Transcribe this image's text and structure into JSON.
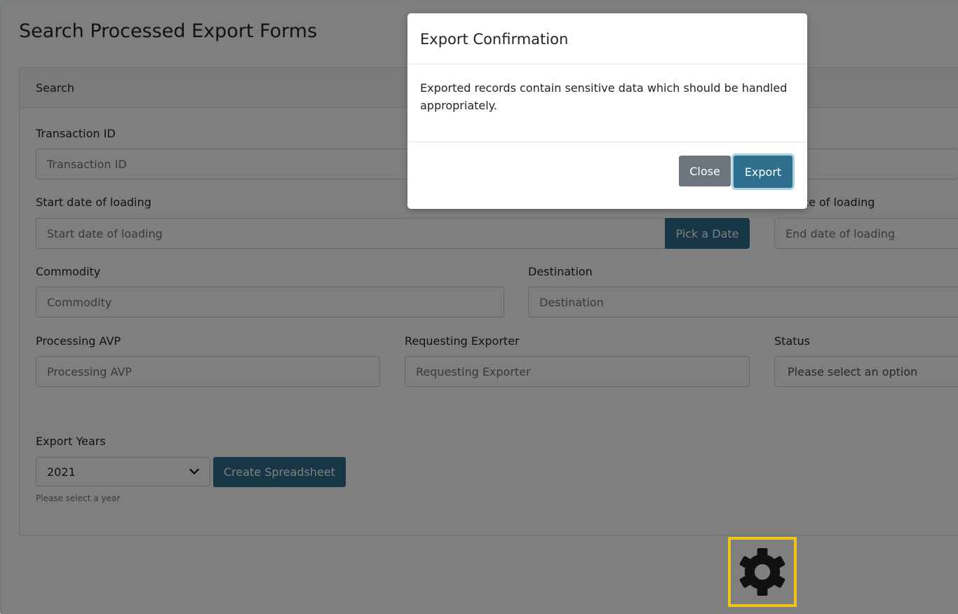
{
  "page": {
    "title": "Search Processed Export Forms"
  },
  "search_card": {
    "header": "Search",
    "transaction_id": {
      "label": "Transaction ID",
      "placeholder": "Transaction ID"
    },
    "start_date": {
      "label": "Start date of loading",
      "placeholder": "Start date of loading",
      "button": "Pick a Date"
    },
    "end_date": {
      "label": "ate of loading",
      "placeholder": "End date of loading"
    },
    "commodity": {
      "label": "Commodity",
      "placeholder": "Commodity"
    },
    "destination": {
      "label": "Destination",
      "placeholder": "Destination"
    },
    "processing_avp": {
      "label": "Processing AVP",
      "placeholder": "Processing AVP"
    },
    "requesting_exporter": {
      "label": "Requesting Exporter",
      "placeholder": "Requesting Exporter"
    },
    "status": {
      "label": "Status",
      "value": "Please select an option"
    },
    "export_years": {
      "label": "Export Years",
      "value": "2021",
      "helper": "Please select a year",
      "button": "Create Spreadsheet"
    }
  },
  "modal": {
    "title": "Export Confirmation",
    "body": "Exported records contain sensitive data which should be handled appropriately.",
    "close_label": "Close",
    "export_label": "Export"
  },
  "colors": {
    "accent": "#2e6f8e",
    "highlight": "#f1c40f",
    "overlay": "#000000"
  },
  "icons": {
    "settings": "gear-icon",
    "select_arrow": "chevron-down-icon"
  }
}
